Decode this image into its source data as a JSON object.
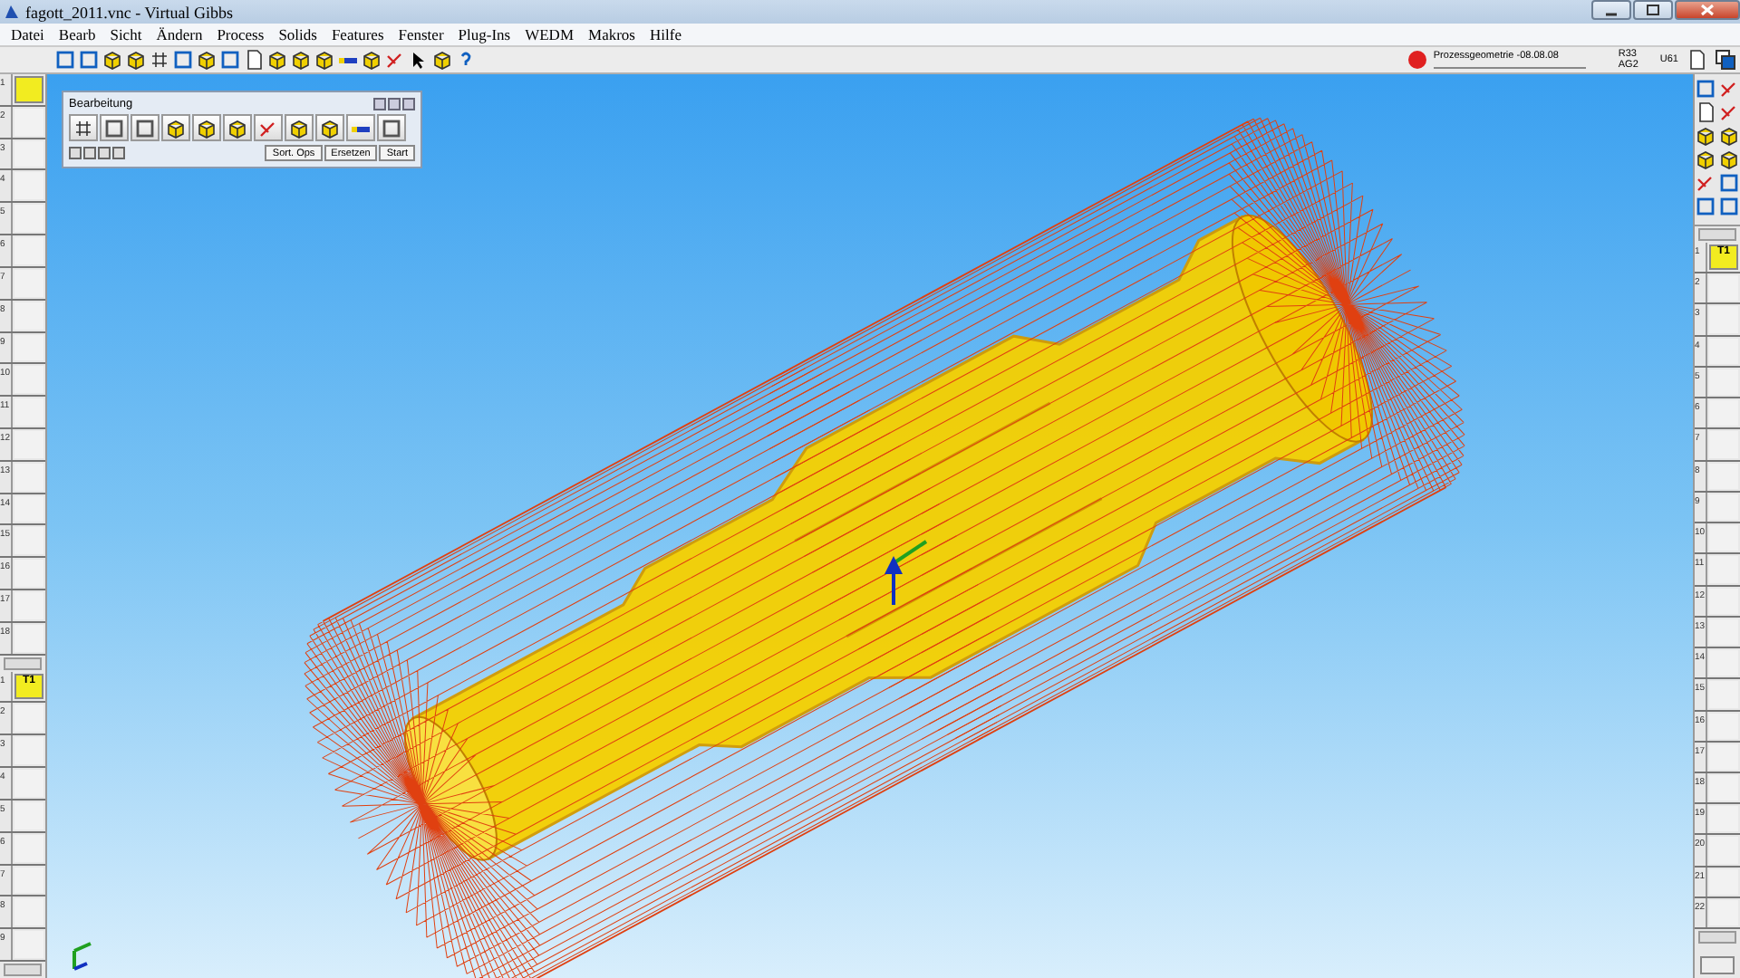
{
  "window": {
    "title": "fagott_2011.vnc - Virtual Gibbs"
  },
  "menu": [
    "Datei",
    "Bearb",
    "Sicht",
    "Ändern",
    "Process",
    "Solids",
    "Features",
    "Fenster",
    "Plug-Ins",
    "WEDM",
    "Makros",
    "Hilfe"
  ],
  "status": {
    "process": "Prozessgeometrie -08.08.08",
    "r": "R33",
    "ag": "AG2",
    "u": "U61"
  },
  "operations_list": {
    "slots": [
      {
        "number": "1",
        "filled": true
      },
      {
        "number": "2",
        "filled": false
      },
      {
        "number": "3",
        "filled": false
      },
      {
        "number": "4",
        "filled": false
      },
      {
        "number": "5",
        "filled": false
      },
      {
        "number": "6",
        "filled": false
      },
      {
        "number": "7",
        "filled": false
      },
      {
        "number": "8",
        "filled": false
      },
      {
        "number": "9",
        "filled": false
      },
      {
        "number": "10",
        "filled": false
      },
      {
        "number": "11",
        "filled": false
      },
      {
        "number": "12",
        "filled": false
      },
      {
        "number": "13",
        "filled": false
      },
      {
        "number": "14",
        "filled": false
      },
      {
        "number": "15",
        "filled": false
      },
      {
        "number": "16",
        "filled": false
      },
      {
        "number": "17",
        "filled": false
      },
      {
        "number": "18",
        "filled": false
      }
    ]
  },
  "tools_left": {
    "slots": [
      {
        "number": "1",
        "label": "T1",
        "filled": true
      },
      {
        "number": "2",
        "filled": false
      },
      {
        "number": "3",
        "filled": false
      },
      {
        "number": "4",
        "filled": false
      },
      {
        "number": "5",
        "filled": false
      },
      {
        "number": "6",
        "filled": false
      },
      {
        "number": "7",
        "filled": false
      },
      {
        "number": "8",
        "filled": false
      },
      {
        "number": "9",
        "filled": false
      }
    ]
  },
  "tools_right": {
    "slots": [
      {
        "number": "1",
        "label": "T1",
        "filled": true
      },
      {
        "number": "2",
        "filled": false
      },
      {
        "number": "3",
        "filled": false
      },
      {
        "number": "4",
        "filled": false
      },
      {
        "number": "5",
        "filled": false
      },
      {
        "number": "6",
        "filled": false
      },
      {
        "number": "7",
        "filled": false
      },
      {
        "number": "8",
        "filled": false
      },
      {
        "number": "9",
        "filled": false
      },
      {
        "number": "10",
        "filled": false
      },
      {
        "number": "11",
        "filled": false
      },
      {
        "number": "12",
        "filled": false
      },
      {
        "number": "13",
        "filled": false
      },
      {
        "number": "14",
        "filled": false
      },
      {
        "number": "15",
        "filled": false
      },
      {
        "number": "16",
        "filled": false
      },
      {
        "number": "17",
        "filled": false
      },
      {
        "number": "18",
        "filled": false
      },
      {
        "number": "19",
        "filled": false
      },
      {
        "number": "20",
        "filled": false
      },
      {
        "number": "21",
        "filled": false
      },
      {
        "number": "22",
        "filled": false
      }
    ]
  },
  "panel": {
    "title": "Bearbeitung",
    "buttons": [
      "Sort. Ops",
      "Ersetzen",
      "Start"
    ]
  }
}
